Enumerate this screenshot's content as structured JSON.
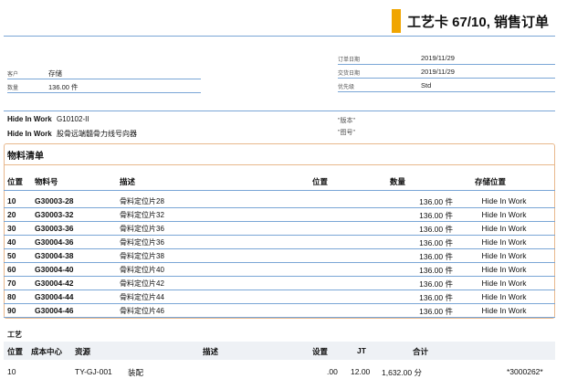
{
  "header": {
    "title": "工艺卡  67/10, 销售订单"
  },
  "order_info": {
    "order_date_label": "订单日期",
    "order_date": "2019/11/29",
    "delivery_date_label": "交货日期",
    "delivery_date": "2019/11/29",
    "priority_label": "优先级",
    "priority": "Std"
  },
  "customer_info": {
    "customer_label": "客户",
    "customer": "存储",
    "quantity_label": "数量",
    "quantity": "136.00 件"
  },
  "product_info": {
    "line1_label": "Hide In Work",
    "line1_value": "G10102-II",
    "line2_label": "Hide In Work",
    "line2_value": "股骨远端髓骨力线号向器",
    "version_label": "\"版本\"",
    "drawing_label": "\"图号\""
  },
  "bom": {
    "title": "物料清单",
    "columns": {
      "pos": "位置",
      "material_no": "物料号",
      "desc": "描述",
      "location": "位置",
      "qty": "数量",
      "storage": "存储位置"
    },
    "rows": [
      {
        "pos": "10",
        "no": "G30003-28",
        "desc": "骨料定位片28",
        "qty": "136.00 件",
        "loc": "Hide In Work"
      },
      {
        "pos": "20",
        "no": "G30003-32",
        "desc": "骨料定位片32",
        "qty": "136.00 件",
        "loc": "Hide In Work"
      },
      {
        "pos": "30",
        "no": "G30003-36",
        "desc": "骨料定位片36",
        "qty": "136.00 件",
        "loc": "Hide In Work"
      },
      {
        "pos": "40",
        "no": "G30004-36",
        "desc": "骨料定位片36",
        "qty": "136.00 件",
        "loc": "Hide In Work"
      },
      {
        "pos": "50",
        "no": "G30004-38",
        "desc": "骨料定位片38",
        "qty": "136.00 件",
        "loc": "Hide In Work"
      },
      {
        "pos": "60",
        "no": "G30004-40",
        "desc": "骨料定位片40",
        "qty": "136.00 件",
        "loc": "Hide In Work"
      },
      {
        "pos": "70",
        "no": "G30004-42",
        "desc": "骨料定位片42",
        "qty": "136.00 件",
        "loc": "Hide In Work"
      },
      {
        "pos": "80",
        "no": "G30004-44",
        "desc": "骨料定位片44",
        "qty": "136.00 件",
        "loc": "Hide In Work"
      },
      {
        "pos": "90",
        "no": "G30004-46",
        "desc": "骨料定位片46",
        "qty": "136.00 件",
        "loc": "Hide In Work"
      }
    ]
  },
  "routing": {
    "title": "工艺",
    "columns": {
      "pos": "位置",
      "cost_center": "成本中心",
      "resource": "资源",
      "desc": "描述",
      "setup": "设置",
      "jt": "JT",
      "total": "合计"
    },
    "rows": [
      {
        "pos": "10",
        "cost_center": "TY-GJ-001",
        "resource": "装配",
        "setup": ".00",
        "jt": "12.00",
        "total": "1,632.00 分",
        "code": "*3000262*"
      }
    ]
  },
  "colors": {
    "accent": "#f0a500",
    "rule": "#7aa6d6",
    "box_border": "#e8b88c"
  }
}
